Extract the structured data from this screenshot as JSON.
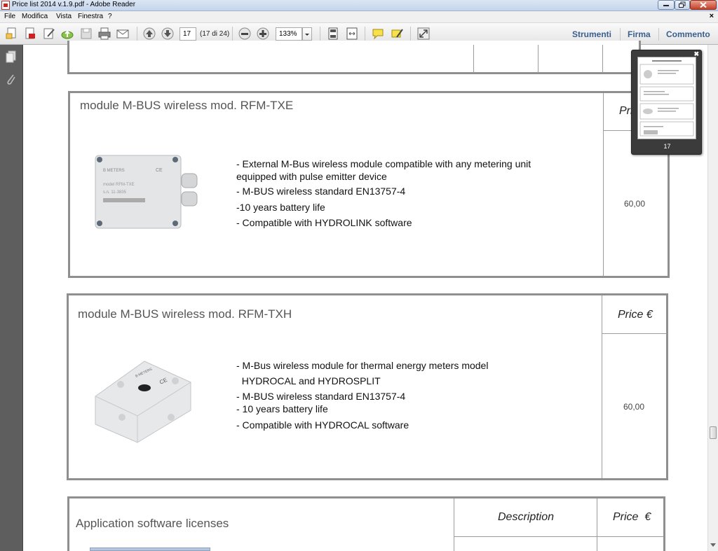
{
  "window": {
    "title": "Price list 2014 v.1.9.pdf - Adobe Reader"
  },
  "menu": {
    "items": [
      "File",
      "Modifica",
      "Vista",
      "Finestra",
      "?"
    ],
    "close": "×"
  },
  "toolbar": {
    "page_current": "17",
    "page_of": "(17 di 24)",
    "zoom": "133%",
    "links": [
      "Strumenti",
      "Firma",
      "Commento"
    ]
  },
  "thumbnail": {
    "page_number": "17"
  },
  "products": [
    {
      "title": "module M-BUS wireless mod. RFM-TXE",
      "price_header": "Pri",
      "price": "60,00",
      "features": [
        "- External M-Bus wireless module compatible with any metering unit",
        "equipped with pulse emitter device",
        "- M-BUS wireless standard EN13757-4",
        "-10 years battery life",
        "- Compatible with HYDROLINK software"
      ],
      "device_label": [
        "B METERS",
        "model RFM-TXE",
        "s.n. 11-3835",
        "CE"
      ]
    },
    {
      "title": "module M-BUS wireless mod. RFM-TXH",
      "price_header": "Price €",
      "price": "60,00",
      "features": [
        "- M-Bus wireless module for thermal energy meters model",
        "  HYDROCAL and HYDROSPLIT",
        "- M-BUS wireless standard EN13757-4",
        "- 10 years battery life",
        "- Compatible with HYDROCAL software"
      ],
      "device_label": [
        "B METERS",
        "CE"
      ]
    }
  ],
  "software": {
    "title": "Application software licenses",
    "description_header": "Description",
    "price_header": "Price  €"
  },
  "colors": {
    "box_border": "#8f8f8f",
    "link": "#3a5f8f",
    "left_pane": "#5e5e5e"
  }
}
